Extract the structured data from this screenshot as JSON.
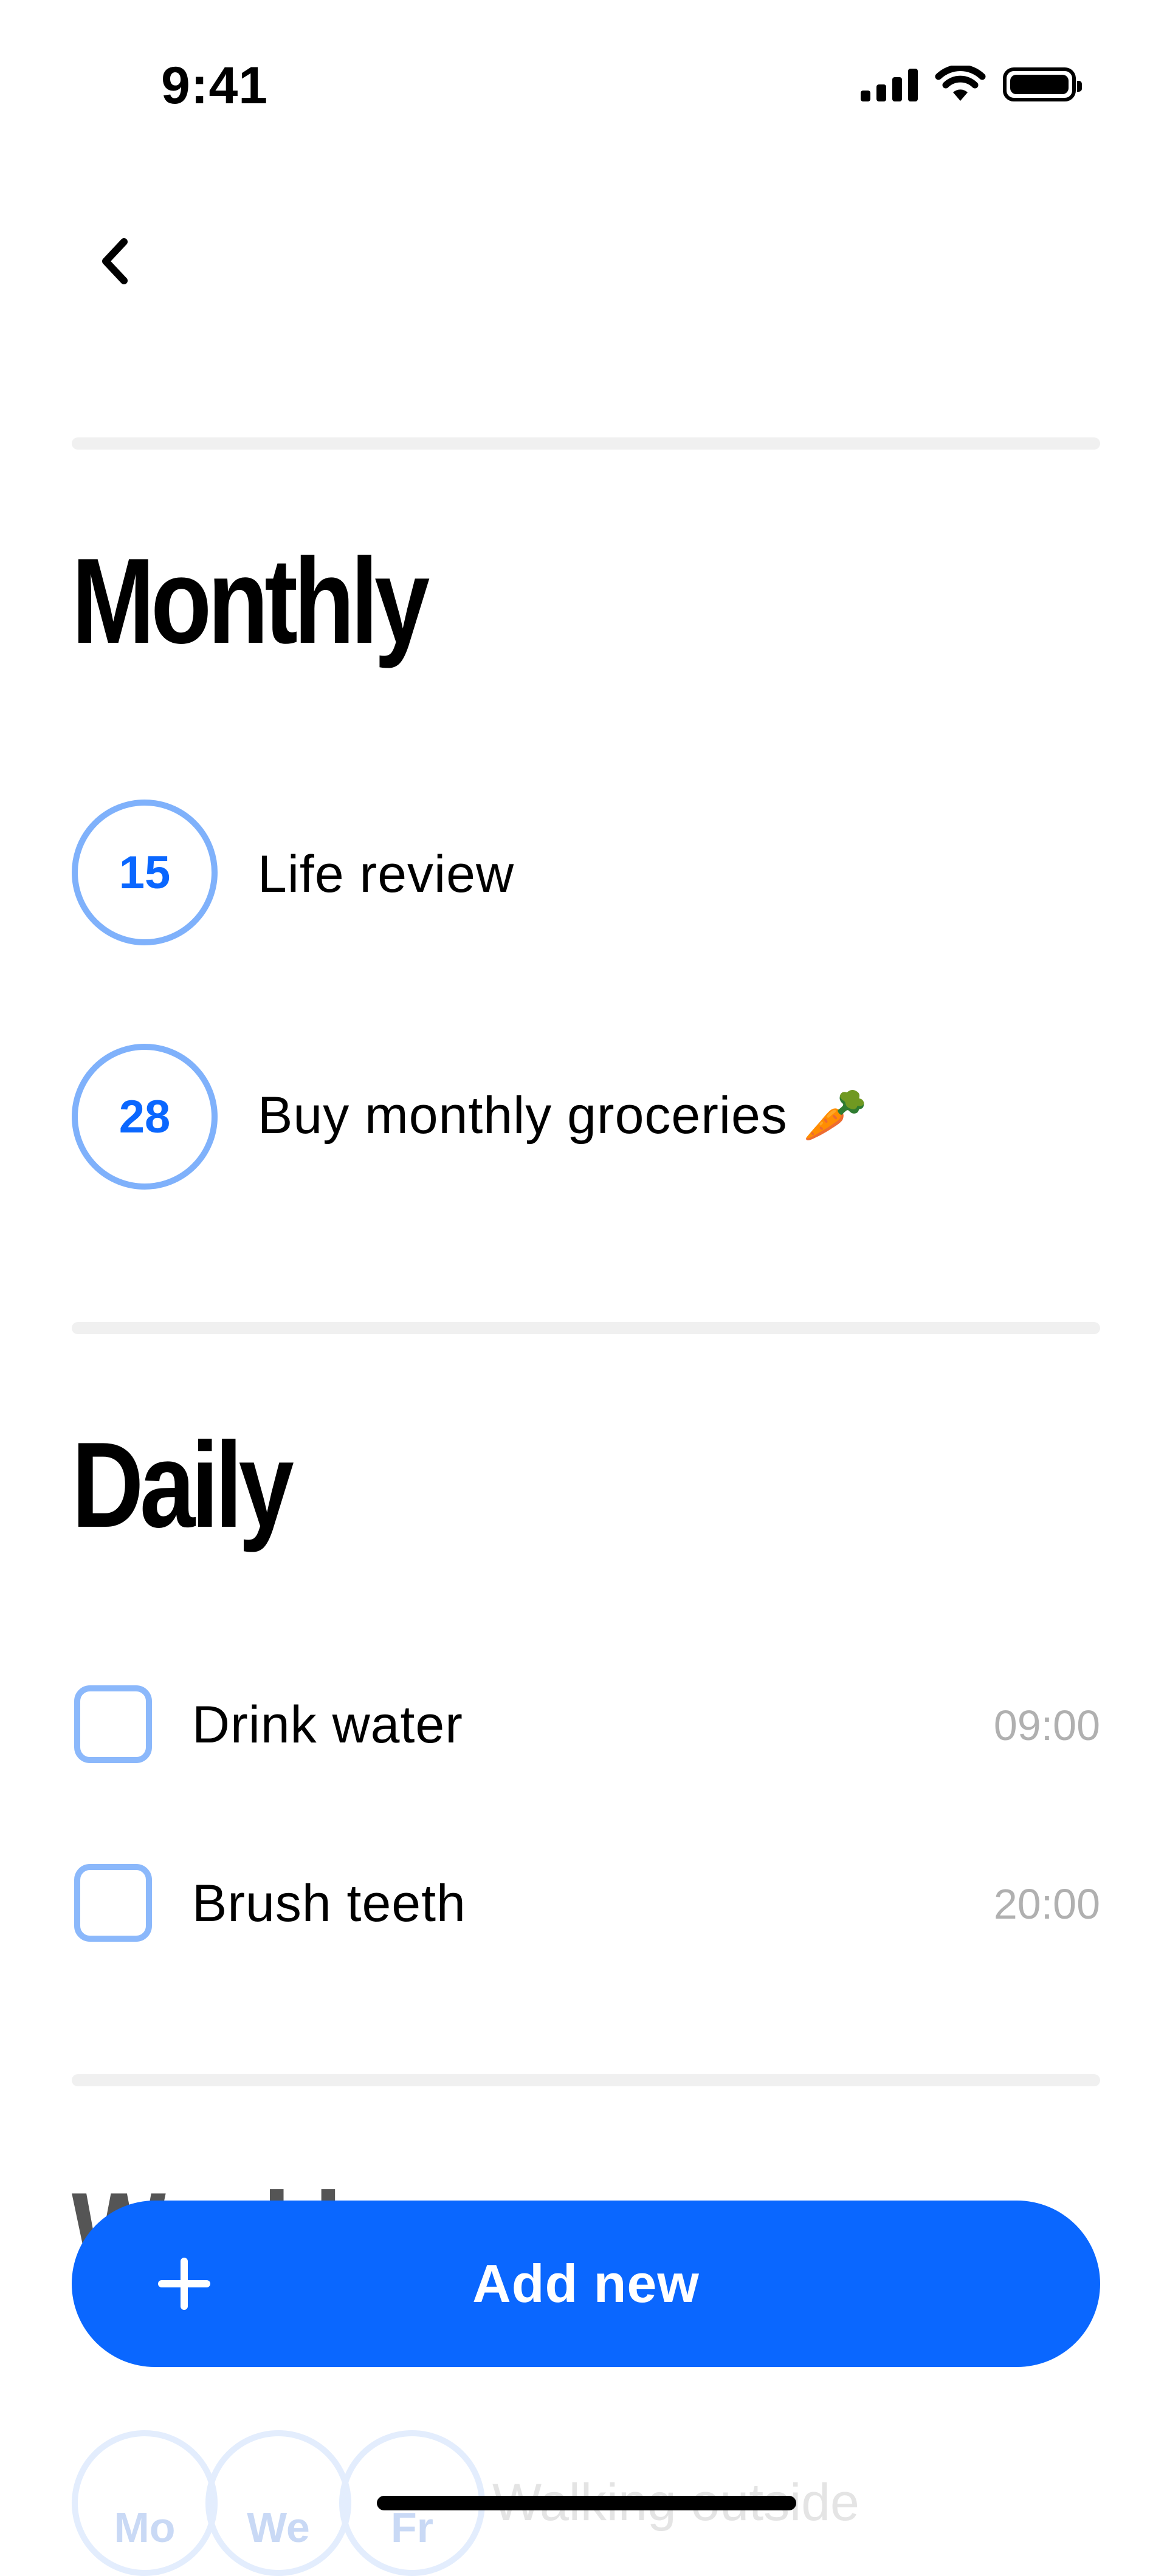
{
  "status_bar": {
    "time": "9:41"
  },
  "sections": {
    "monthly": {
      "title": "Monthly",
      "items": [
        {
          "day": "15",
          "label": "Life review"
        },
        {
          "day": "28",
          "label": "Buy monthly groceries 🥕"
        }
      ]
    },
    "daily": {
      "title": "Daily",
      "items": [
        {
          "label": "Drink water",
          "time": "09:00"
        },
        {
          "label": "Brush teeth",
          "time": "20:00"
        }
      ]
    },
    "weekly_peek": {
      "title": "Weekly",
      "days": [
        "Mo",
        "We",
        "Fr"
      ],
      "label": "Walking outside"
    }
  },
  "add_button": {
    "label": "Add new"
  },
  "colors": {
    "accent": "#0a67ff",
    "circle_border": "#7fb1fb",
    "muted": "#b0b0b0"
  }
}
